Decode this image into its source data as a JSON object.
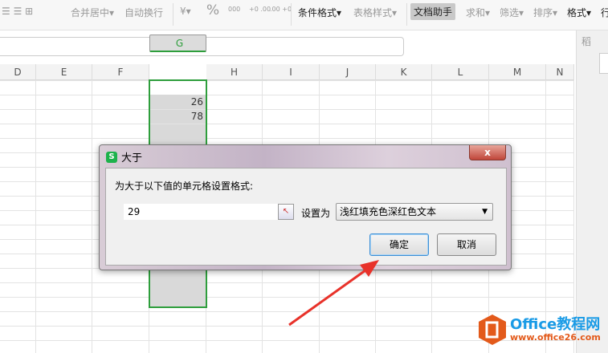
{
  "toolbar": {
    "merge": "合并居中",
    "wrap": "自动换行",
    "currency": "¥",
    "percent": "%",
    "thousands": "000",
    "dec_inc": "+0 .00",
    "dec_dec": ".00 +0",
    "cond_format": "条件格式",
    "table_style": "表格样式",
    "doc_helper": "文档助手",
    "sum": "求和",
    "filter": "筛选",
    "sort": "排序",
    "format": "格式",
    "rows": "行"
  },
  "columns": [
    "D",
    "E",
    "F",
    "G",
    "H",
    "I",
    "J",
    "K",
    "L",
    "M",
    "N"
  ],
  "cells": {
    "g3": "26",
    "g4": "78"
  },
  "right_panel": {
    "label": "稻",
    "btn": "f"
  },
  "dialog": {
    "title": "大于",
    "prompt": "为大于以下值的单元格设置格式:",
    "value": "29",
    "set_as_label": "设置为",
    "format_option": "浅红填充色深红色文本",
    "ok": "确定",
    "cancel": "取消",
    "close": "x"
  },
  "watermark": {
    "brand": "Office教程网",
    "url": "www.office26.com"
  }
}
